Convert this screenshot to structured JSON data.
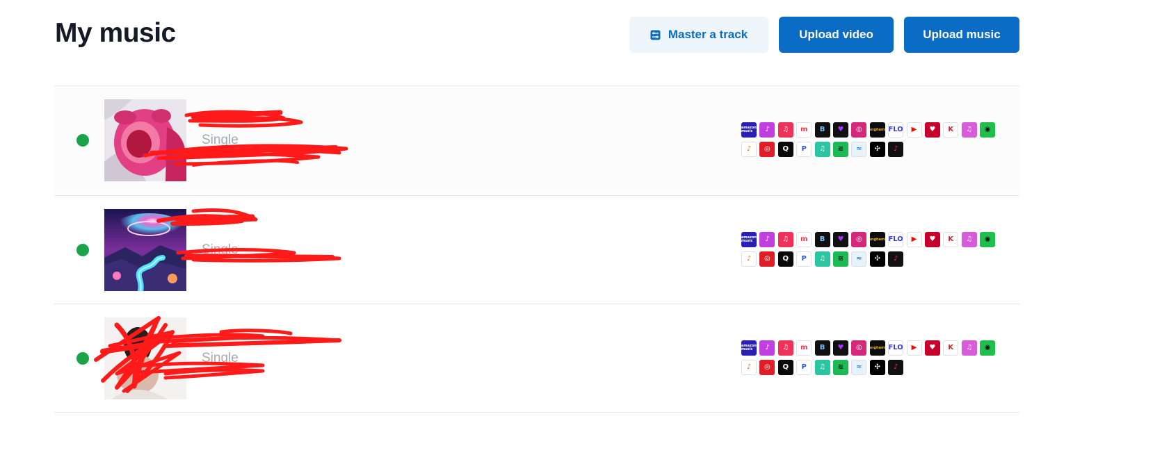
{
  "header": {
    "title": "My music",
    "master_label": "Master a track",
    "upload_video_label": "Upload video",
    "upload_music_label": "Upload music"
  },
  "colors": {
    "primary": "#0a6cc4",
    "primary_soft_bg": "#eef5fb",
    "status_live": "#1aa44a",
    "redaction": "#ff1a1a"
  },
  "tracks": [
    {
      "title": "",
      "type": "Single",
      "subtitle": "",
      "status": "live",
      "cover": "pink-plush-cover",
      "redacted": true
    },
    {
      "title": "",
      "type": "Single",
      "subtitle": "",
      "status": "live",
      "cover": "galaxy-river-cover",
      "redacted": true
    },
    {
      "title": "",
      "type": "Single",
      "subtitle": "",
      "status": "live",
      "cover": "portrait-cover",
      "redacted": true
    }
  ],
  "platforms_row1": [
    {
      "name": "amazon-music-icon",
      "glyph": "amazon music",
      "bg": "#2a1fb4",
      "fg": "#ffffff"
    },
    {
      "name": "deezer-like-icon",
      "glyph": "♪",
      "bg": "#c13ee0",
      "fg": "#ffffff"
    },
    {
      "name": "apple-music-icon",
      "glyph": "♫",
      "bg": "#f0325a",
      "fg": "#ffffff"
    },
    {
      "name": "melon-icon",
      "glyph": "m",
      "bg": "#ffffff",
      "fg": "#e83a52"
    },
    {
      "name": "boomplay-icon",
      "glyph": "B",
      "bg": "#101010",
      "fg": "#7ac4ff"
    },
    {
      "name": "deezer-icon",
      "glyph": "♥",
      "bg": "#111111",
      "fg": "#a238ff"
    },
    {
      "name": "instagram-icon",
      "glyph": "◎",
      "bg": "#d6287a",
      "fg": "#ffffff"
    },
    {
      "name": "anghami-icon",
      "glyph": "anghami",
      "bg": "#0c0c0c",
      "fg": "#f7b500"
    },
    {
      "name": "flo-icon",
      "glyph": "FLO",
      "bg": "#ffffff",
      "fg": "#3b3bd6"
    },
    {
      "name": "youtube-music-icon",
      "glyph": "▶",
      "bg": "#ffffff",
      "fg": "#ff0000"
    },
    {
      "name": "iheartradio-icon",
      "glyph": "♥",
      "bg": "#c6002b",
      "fg": "#ffffff"
    },
    {
      "name": "kkbox-icon",
      "glyph": "K",
      "bg": "#ffffff",
      "fg": "#c62828"
    },
    {
      "name": "itunes-icon",
      "glyph": "♫",
      "bg": "#d85bd9",
      "fg": "#ffffff"
    },
    {
      "name": "audiomack-icon",
      "glyph": "◉",
      "bg": "#1fbf4e",
      "fg": "#111111"
    }
  ],
  "platforms_row2": [
    {
      "name": "joox-icon",
      "glyph": "♪",
      "bg": "#ffffff",
      "fg": "#e86a10"
    },
    {
      "name": "netease-music-icon",
      "glyph": "◎",
      "bg": "#e01e25",
      "fg": "#ffffff"
    },
    {
      "name": "qobuz-icon",
      "glyph": "Q",
      "bg": "#0a0a0a",
      "fg": "#ffffff"
    },
    {
      "name": "pandora-icon",
      "glyph": "P",
      "bg": "#ffffff",
      "fg": "#2a5bd7"
    },
    {
      "name": "jiosaavn-icon",
      "glyph": "♫",
      "bg": "#2bc5a1",
      "fg": "#ffffff"
    },
    {
      "name": "spotify-icon",
      "glyph": "≋",
      "bg": "#1db954",
      "fg": "#111111"
    },
    {
      "name": "tidal-like-icon",
      "glyph": "≈",
      "bg": "#e8f2fb",
      "fg": "#2a7fd4"
    },
    {
      "name": "tidal-icon",
      "glyph": "✣",
      "bg": "#000000",
      "fg": "#ffffff"
    },
    {
      "name": "tiktok-icon",
      "glyph": "♪",
      "bg": "#111111",
      "fg": "#ff2e63"
    }
  ]
}
